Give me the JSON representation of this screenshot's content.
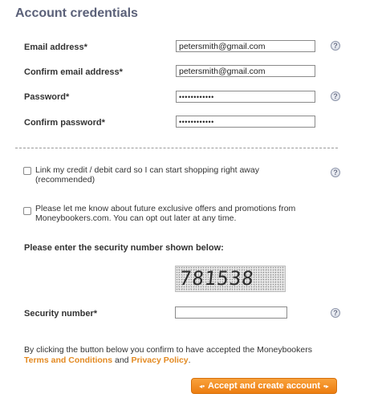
{
  "section_title": "Account credentials",
  "fields": {
    "email": {
      "label": "Email address*",
      "value": "petersmith@gmail.com"
    },
    "confirm_email": {
      "label": "Confirm email address*",
      "value": "petersmith@gmail.com"
    },
    "password": {
      "label": "Password*",
      "value": "••••••••••••"
    },
    "confirm_password": {
      "label": "Confirm password*",
      "value": "••••••••••••"
    }
  },
  "help_glyph": "?",
  "checkboxes": {
    "link_card": {
      "text": "Link my credit / debit card so I can start shopping right away (recommended)",
      "checked": false
    },
    "offers": {
      "text": "Please let me know about future exclusive offers and promotions from Moneybookers.com. You can opt out later at any time.",
      "checked": false
    }
  },
  "security": {
    "prompt": "Please enter the security number shown below:",
    "captcha_text": "781538",
    "label": "Security number*",
    "value": ""
  },
  "consent": {
    "text": "By clicking the button below you confirm to have accepted the Moneybookers",
    "terms_link": "Terms and Conditions",
    "and": "and",
    "privacy_link": "Privacy Policy",
    "period": "."
  },
  "submit_button": {
    "label": "Accept and create account",
    "left_arrow": "◂•",
    "right_arrow": "•▸"
  },
  "colors": {
    "title": "#5b6179",
    "link": "#e38a22",
    "button": "#f39325"
  }
}
